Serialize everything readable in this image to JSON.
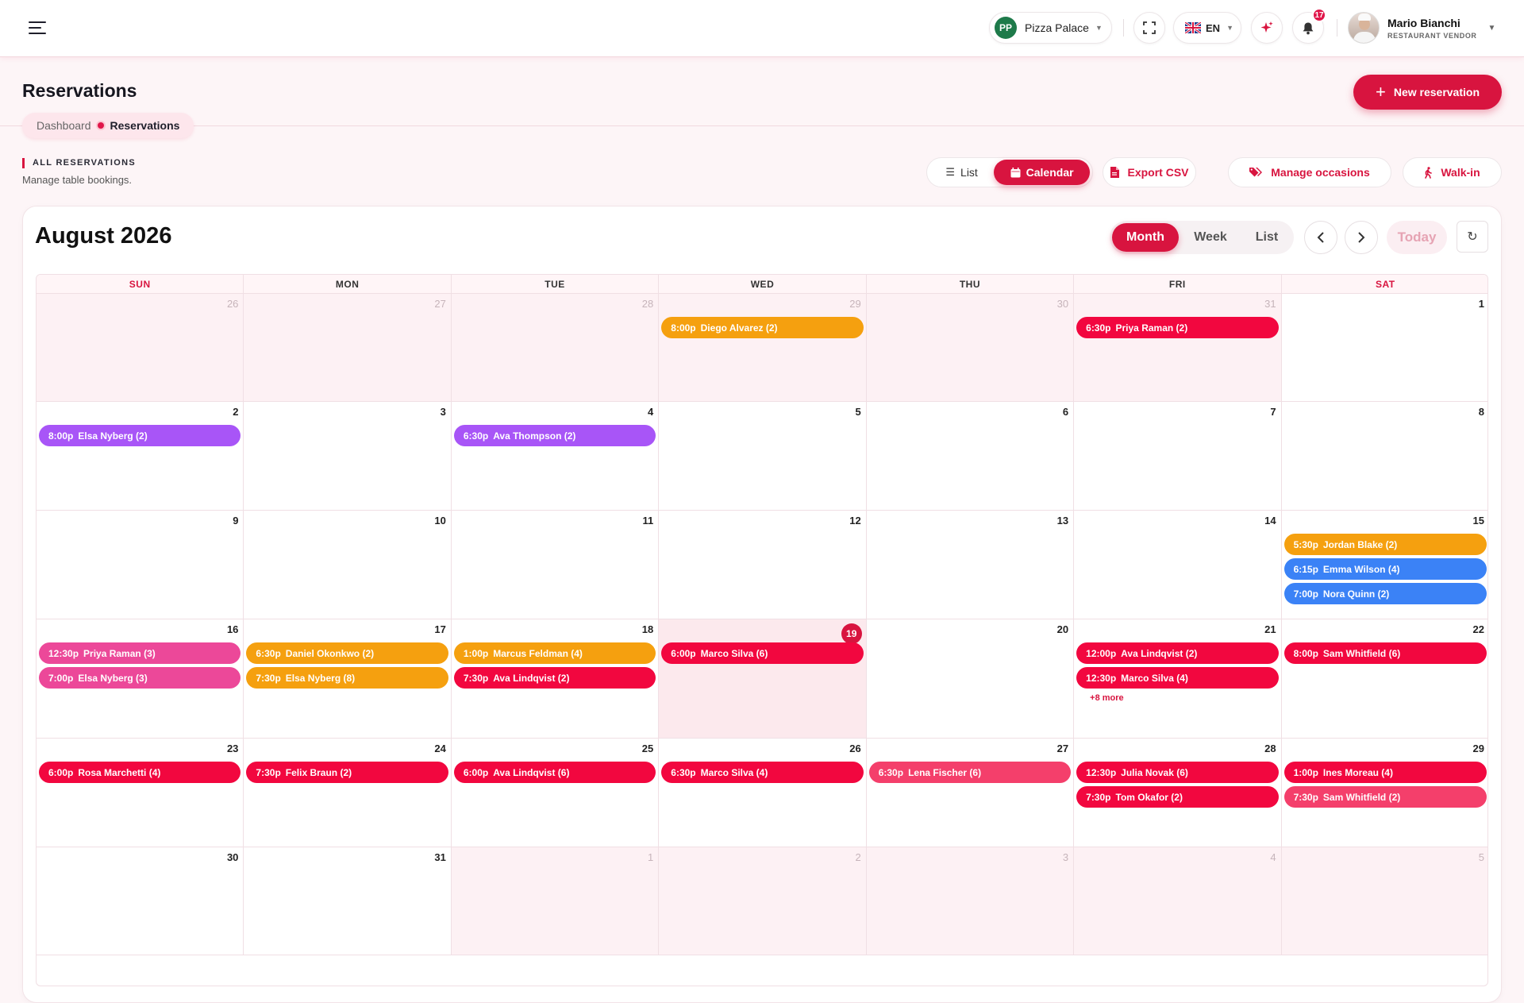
{
  "header": {
    "store": {
      "initials": "PP",
      "name": "Pizza Palace"
    },
    "language": "EN",
    "notifications_count": "17",
    "user": {
      "name": "Mario Bianchi",
      "role": "RESTAURANT VENDOR"
    }
  },
  "page": {
    "title": "Reservations",
    "breadcrumb": [
      "Dashboard",
      "Reservations"
    ],
    "new_button": "New reservation",
    "section_label": "ALL RESERVATIONS",
    "section_subtitle": "Manage table bookings."
  },
  "toolbar": {
    "list_label": "List",
    "calendar_label": "Calendar",
    "export_label": "Export CSV",
    "occasions_label": "Manage occasions",
    "walkin_label": "Walk-in"
  },
  "calendar": {
    "title": "August 2026",
    "views": [
      "Month",
      "Week",
      "List"
    ],
    "active_view": "Month",
    "today_label": "Today",
    "weekdays": [
      "SUN",
      "MON",
      "TUE",
      "WED",
      "THU",
      "FRI",
      "SAT"
    ],
    "weeks": [
      [
        {
          "day": "26",
          "out": true,
          "events": []
        },
        {
          "day": "27",
          "out": true,
          "events": []
        },
        {
          "day": "28",
          "out": true,
          "events": []
        },
        {
          "day": "29",
          "out": true,
          "events": [
            {
              "time": "8:00p",
              "name": "Diego Alvarez (2)",
              "color": "#f5a00f"
            }
          ]
        },
        {
          "day": "30",
          "out": true,
          "events": []
        },
        {
          "day": "31",
          "out": true,
          "events": [
            {
              "time": "6:30p",
              "name": "Priya Raman (2)",
              "color": "#f2073f"
            }
          ]
        },
        {
          "day": "1",
          "events": []
        }
      ],
      [
        {
          "day": "2",
          "events": [
            {
              "time": "8:00p",
              "name": "Elsa Nyberg (2)",
              "color": "#a855f7"
            }
          ]
        },
        {
          "day": "3",
          "events": []
        },
        {
          "day": "4",
          "events": [
            {
              "time": "6:30p",
              "name": "Ava Thompson (2)",
              "color": "#a855f7"
            }
          ]
        },
        {
          "day": "5",
          "events": []
        },
        {
          "day": "6",
          "events": []
        },
        {
          "day": "7",
          "events": []
        },
        {
          "day": "8",
          "events": []
        }
      ],
      [
        {
          "day": "9",
          "events": []
        },
        {
          "day": "10",
          "events": []
        },
        {
          "day": "11",
          "events": []
        },
        {
          "day": "12",
          "events": []
        },
        {
          "day": "13",
          "events": []
        },
        {
          "day": "14",
          "events": []
        },
        {
          "day": "15",
          "events": [
            {
              "time": "5:30p",
              "name": "Jordan Blake (2)",
              "color": "#f5a00f"
            },
            {
              "time": "6:15p",
              "name": "Emma Wilson (4)",
              "color": "#3b82f6"
            },
            {
              "time": "7:00p",
              "name": "Nora Quinn (2)",
              "color": "#3b82f6"
            }
          ]
        }
      ],
      [
        {
          "day": "16",
          "events": [
            {
              "time": "12:30p",
              "name": "Priya Raman (3)",
              "color": "#ec4899"
            },
            {
              "time": "7:00p",
              "name": "Elsa Nyberg (3)",
              "color": "#ec4899"
            }
          ]
        },
        {
          "day": "17",
          "events": [
            {
              "time": "6:30p",
              "name": "Daniel Okonkwo (2)",
              "color": "#f5a00f"
            },
            {
              "time": "7:30p",
              "name": "Elsa Nyberg (8)",
              "color": "#f5a00f"
            }
          ]
        },
        {
          "day": "18",
          "events": [
            {
              "time": "1:00p",
              "name": "Marcus Feldman (4)",
              "color": "#f5a00f"
            },
            {
              "time": "7:30p",
              "name": "Ava Lindqvist (2)",
              "color": "#f2073f"
            }
          ]
        },
        {
          "day": "19",
          "today": true,
          "events": [
            {
              "time": "6:00p",
              "name": "Marco Silva (6)",
              "color": "#f2073f"
            }
          ]
        },
        {
          "day": "20",
          "events": []
        },
        {
          "day": "21",
          "events": [
            {
              "time": "12:00p",
              "name": "Ava Lindqvist (2)",
              "color": "#f2073f"
            },
            {
              "time": "12:30p",
              "name": "Marco Silva (4)",
              "color": "#f2073f"
            }
          ],
          "more": "+8 more"
        },
        {
          "day": "22",
          "events": [
            {
              "time": "8:00p",
              "name": "Sam Whitfield (6)",
              "color": "#f2073f"
            }
          ]
        }
      ],
      [
        {
          "day": "23",
          "events": [
            {
              "time": "6:00p",
              "name": "Rosa Marchetti (4)",
              "color": "#f2073f"
            }
          ]
        },
        {
          "day": "24",
          "events": [
            {
              "time": "7:30p",
              "name": "Felix Braun (2)",
              "color": "#f2073f"
            }
          ]
        },
        {
          "day": "25",
          "events": [
            {
              "time": "6:00p",
              "name": "Ava Lindqvist (6)",
              "color": "#f2073f"
            }
          ]
        },
        {
          "day": "26",
          "events": [
            {
              "time": "6:30p",
              "name": "Marco Silva (4)",
              "color": "#f2073f"
            }
          ]
        },
        {
          "day": "27",
          "events": [
            {
              "time": "6:30p",
              "name": "Lena Fischer (6)",
              "color": "#f43f6b"
            }
          ]
        },
        {
          "day": "28",
          "events": [
            {
              "time": "12:30p",
              "name": "Julia Novak (6)",
              "color": "#f2073f"
            },
            {
              "time": "7:30p",
              "name": "Tom Okafor (2)",
              "color": "#f2073f"
            }
          ]
        },
        {
          "day": "29",
          "events": [
            {
              "time": "1:00p",
              "name": "Ines Moreau (4)",
              "color": "#f2073f"
            },
            {
              "time": "7:30p",
              "name": "Sam Whitfield (2)",
              "color": "#f43f6b"
            }
          ]
        }
      ],
      [
        {
          "day": "30",
          "events": []
        },
        {
          "day": "31",
          "events": []
        },
        {
          "day": "1",
          "out": true,
          "events": []
        },
        {
          "day": "2",
          "out": true,
          "events": []
        },
        {
          "day": "3",
          "out": true,
          "events": []
        },
        {
          "day": "4",
          "out": true,
          "events": []
        },
        {
          "day": "5",
          "out": true,
          "events": []
        }
      ]
    ]
  }
}
